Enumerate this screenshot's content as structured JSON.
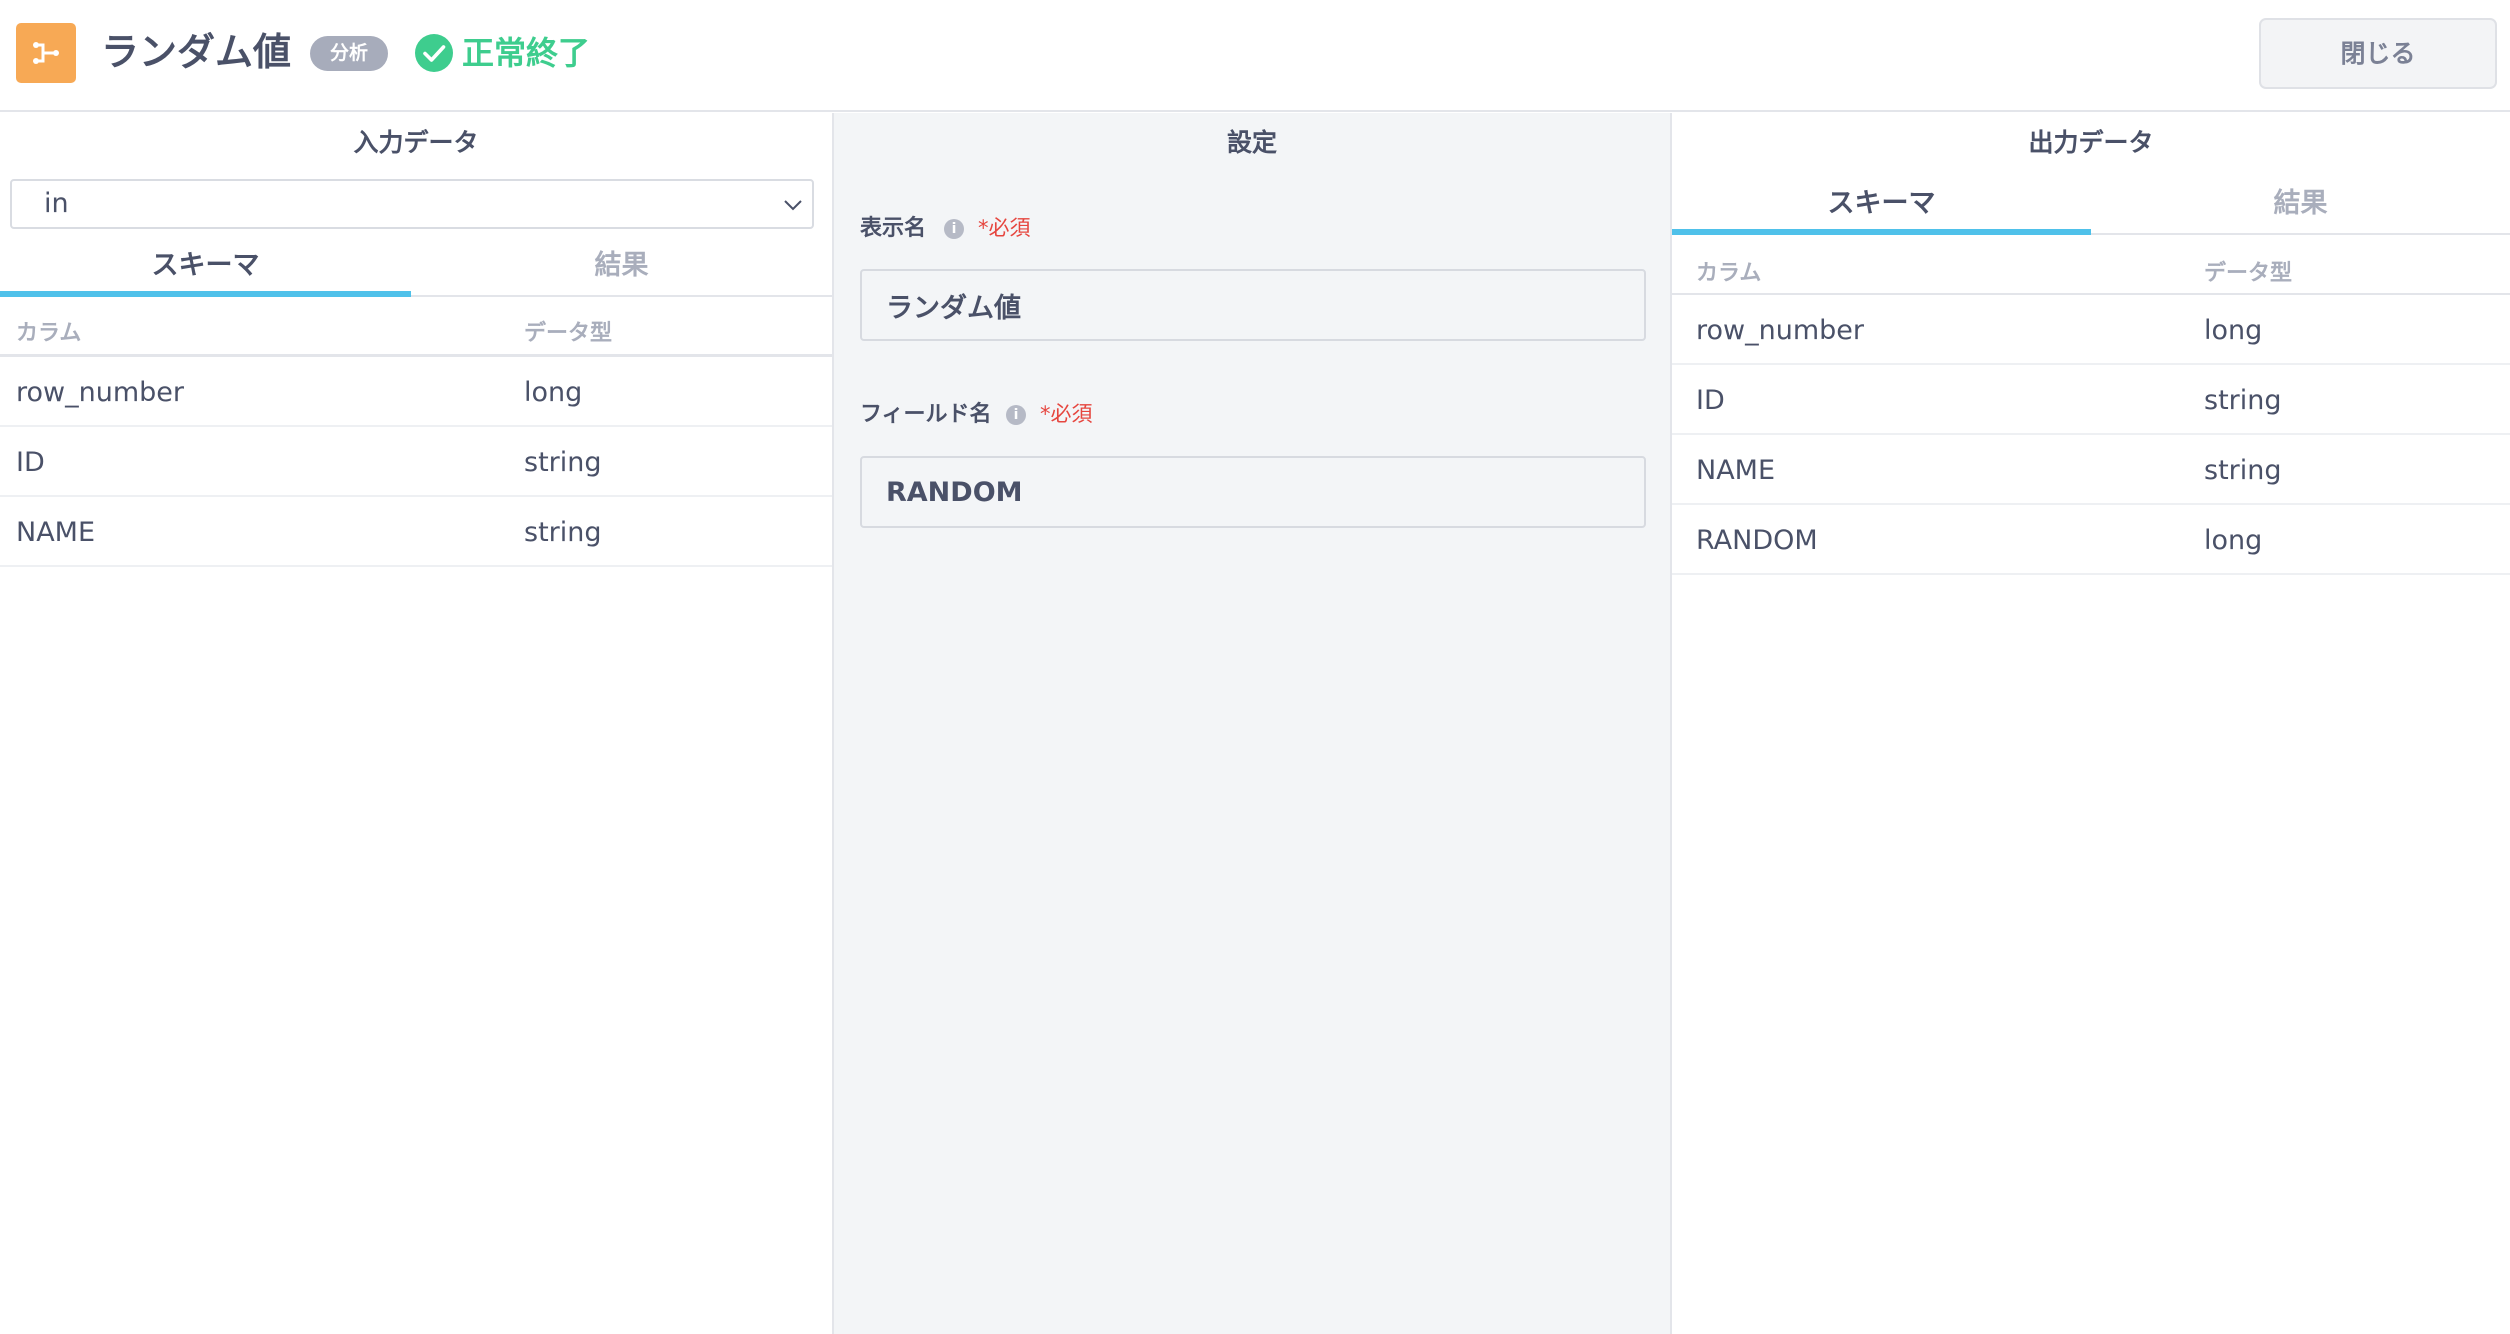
{
  "header": {
    "title": "ランダム値",
    "category_badge": "分析",
    "status_text": "正常終了",
    "status_color": "#3ecd8e",
    "node_icon": "branch-icon",
    "node_icon_color": "#f7a955",
    "close_label": "閉じる"
  },
  "input_panel": {
    "title": "入力データ",
    "selected_input": "in",
    "tabs": [
      {
        "label": "スキーマ",
        "active": true
      },
      {
        "label": "結果",
        "active": false
      }
    ],
    "columns": {
      "name": "カラム",
      "type": "データ型"
    },
    "rows": [
      {
        "name": "row_number",
        "type": "long"
      },
      {
        "name": "ID",
        "type": "string"
      },
      {
        "name": "NAME",
        "type": "string"
      }
    ]
  },
  "settings_panel": {
    "title": "設定",
    "display_name": {
      "label": "表示名",
      "required": "*必須",
      "value": "ランダム値"
    },
    "field_name": {
      "label": "フィールド名",
      "required": "*必須",
      "value": "RANDOM"
    }
  },
  "output_panel": {
    "title": "出力データ",
    "tabs": [
      {
        "label": "スキーマ",
        "active": true
      },
      {
        "label": "結果",
        "active": false
      }
    ],
    "columns": {
      "name": "カラム",
      "type": "データ型"
    },
    "rows": [
      {
        "name": "row_number",
        "type": "long"
      },
      {
        "name": "ID",
        "type": "string"
      },
      {
        "name": "NAME",
        "type": "string"
      },
      {
        "name": "RANDOM",
        "type": "long"
      }
    ]
  },
  "accent_color": "#4fc1ea"
}
